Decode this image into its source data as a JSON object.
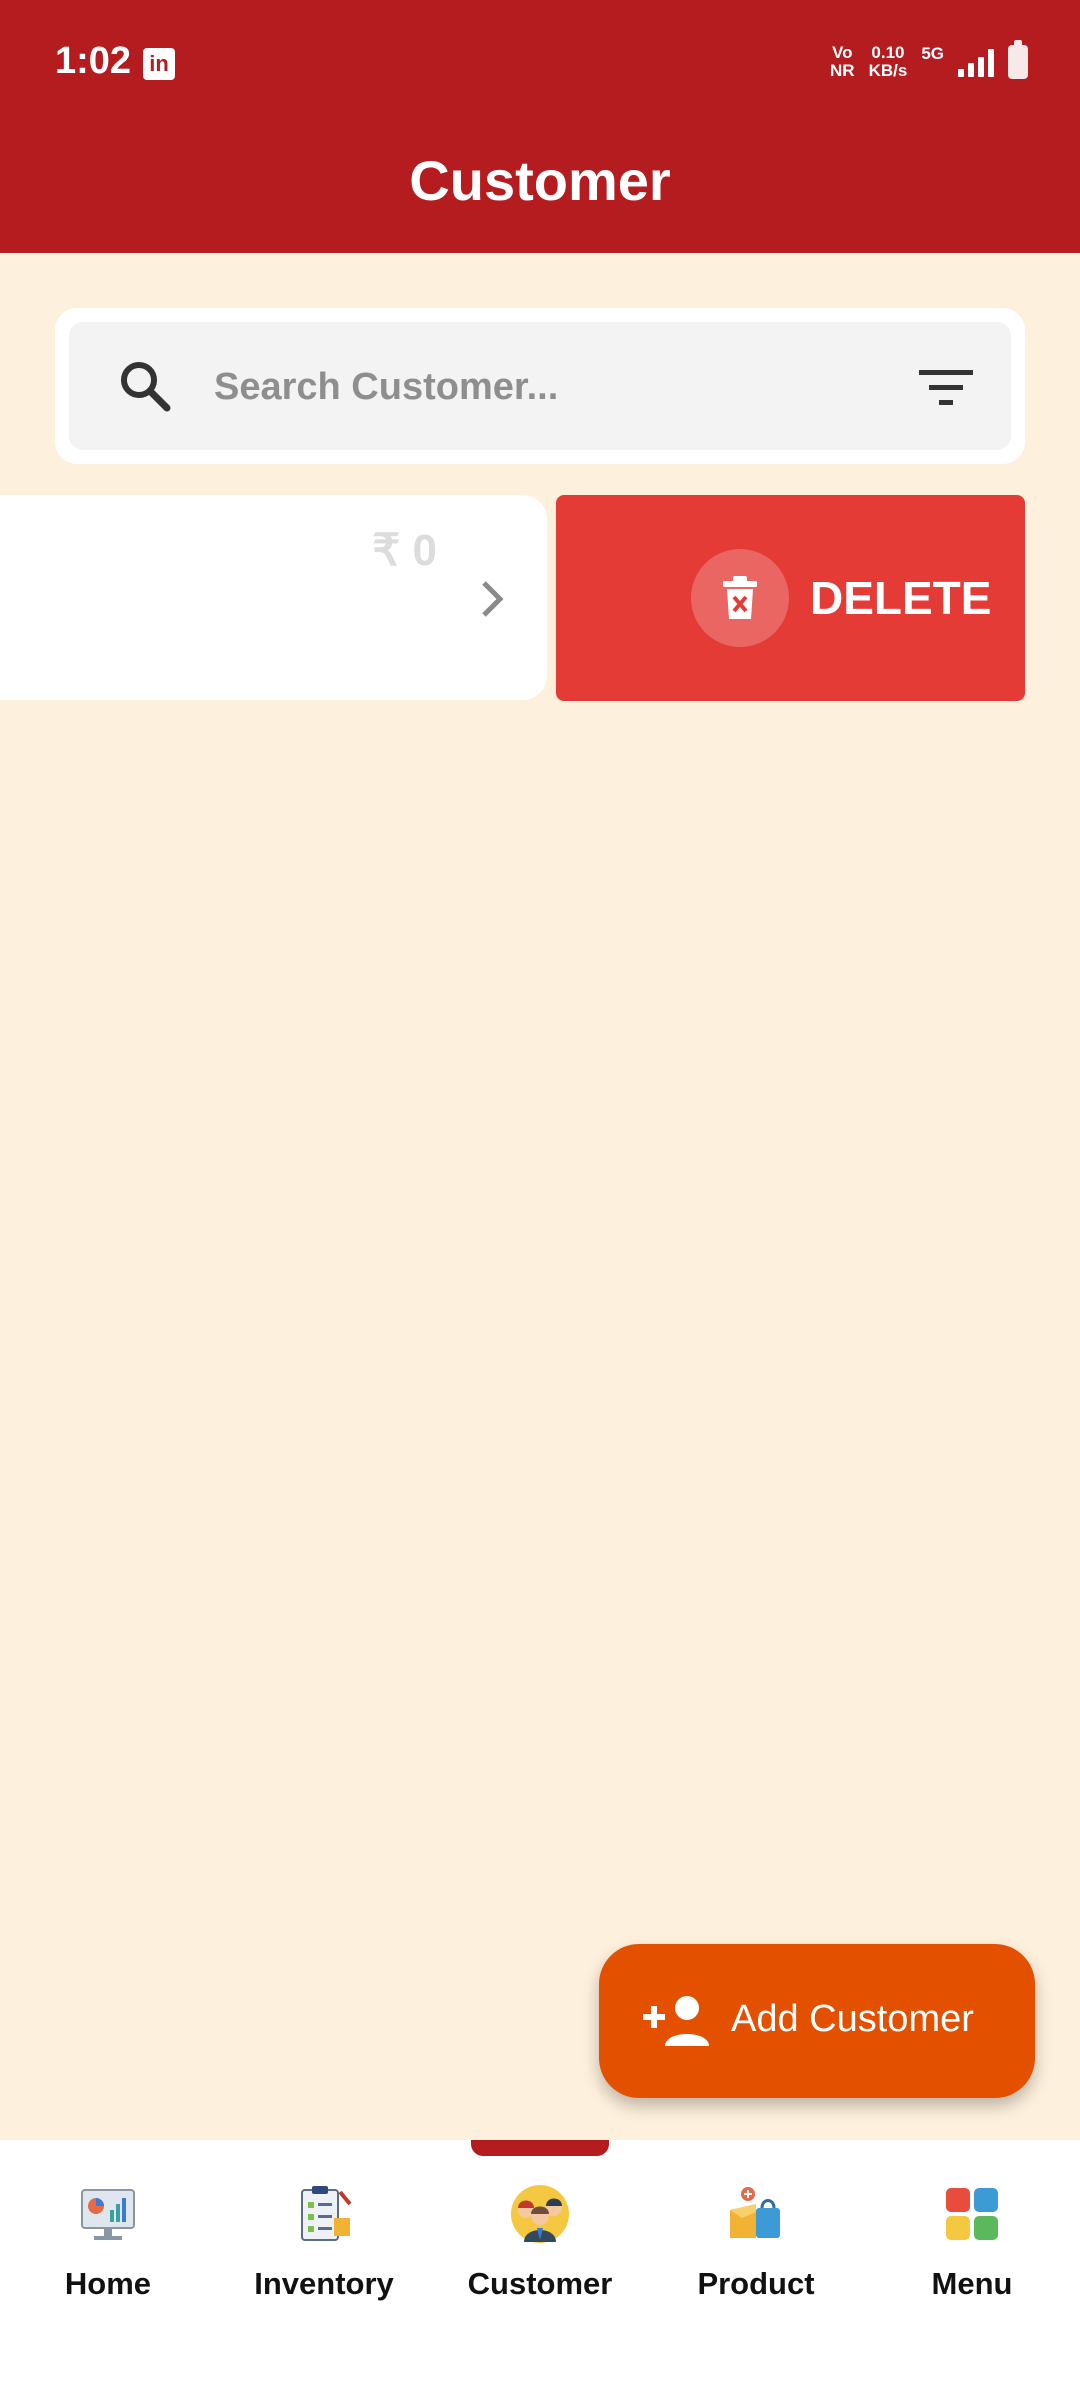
{
  "status_bar": {
    "time": "1:02",
    "app_icon": "linkedin-icon",
    "vo": "Vo",
    "nr": "NR",
    "speed_value": "0.10",
    "speed_unit": "KB/s",
    "network": "5G"
  },
  "header": {
    "title": "Customer"
  },
  "search": {
    "placeholder": "Search Customer..."
  },
  "customer_row": {
    "amount": "₹ 0"
  },
  "swipe_action": {
    "delete_label": "DELETE"
  },
  "fab": {
    "label": "Add Customer"
  },
  "bottom_nav": {
    "items": [
      {
        "label": "Home",
        "icon": "dashboard-icon"
      },
      {
        "label": "Inventory",
        "icon": "checklist-icon"
      },
      {
        "label": "Customer",
        "icon": "customers-icon"
      },
      {
        "label": "Product",
        "icon": "product-box-icon"
      },
      {
        "label": "Menu",
        "icon": "grid-menu-icon"
      }
    ],
    "active_index": 2
  },
  "colors": {
    "primary": "#b51c1f",
    "background": "#fdf0dc",
    "delete": "#e43b37",
    "fab": "#e35000"
  }
}
